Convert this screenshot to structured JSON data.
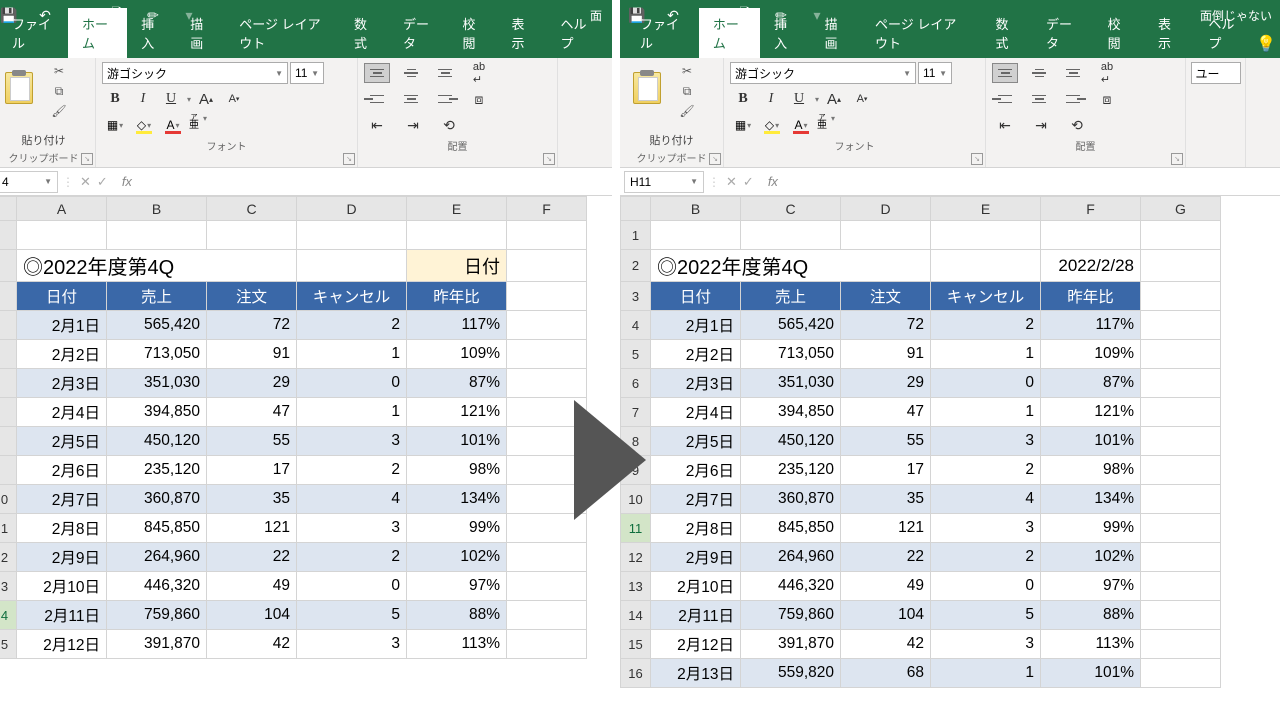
{
  "ribbon": {
    "tabs": [
      "ファイル",
      "ホーム",
      "挿入",
      "描画",
      "ページ レイアウト",
      "数式",
      "データ",
      "校閲",
      "表示",
      "ヘルプ"
    ],
    "paste": "貼り付け",
    "clipboard": "クリップボード",
    "font": "フォント",
    "align": "配置",
    "fontname": "游ゴシック",
    "fontsize": "11",
    "bold": "B",
    "italic": "I",
    "under": "U",
    "userStyle": "ユー"
  },
  "title_left": "面",
  "title_right": "面倒じゃない",
  "left": {
    "namebox": "4",
    "celltitle": "◎2022年度第4Q",
    "datebox": "日付",
    "headers": [
      "日付",
      "売上",
      "注文",
      "キャンセル",
      "昨年比"
    ],
    "rows": [
      [
        "2月1日",
        "565,420",
        "72",
        "2",
        "117%"
      ],
      [
        "2月2日",
        "713,050",
        "91",
        "1",
        "109%"
      ],
      [
        "2月3日",
        "351,030",
        "29",
        "0",
        "87%"
      ],
      [
        "2月4日",
        "394,850",
        "47",
        "1",
        "121%"
      ],
      [
        "2月5日",
        "450,120",
        "55",
        "3",
        "101%"
      ],
      [
        "2月6日",
        "235,120",
        "17",
        "2",
        "98%"
      ],
      [
        "2月7日",
        "360,870",
        "35",
        "4",
        "134%"
      ],
      [
        "2月8日",
        "845,850",
        "121",
        "3",
        "99%"
      ],
      [
        "2月9日",
        "264,960",
        "22",
        "2",
        "102%"
      ],
      [
        "2月10日",
        "446,320",
        "49",
        "0",
        "97%"
      ],
      [
        "2月11日",
        "759,860",
        "104",
        "5",
        "88%"
      ],
      [
        "2月12日",
        "391,870",
        "42",
        "3",
        "113%"
      ]
    ]
  },
  "right": {
    "namebox": "H11",
    "celltitle": "◎2022年度第4Q",
    "datebox": "2022/2/28",
    "headers": [
      "日付",
      "売上",
      "注文",
      "キャンセル",
      "昨年比"
    ],
    "rows": [
      [
        "2月1日",
        "565,420",
        "72",
        "2",
        "117%"
      ],
      [
        "2月2日",
        "713,050",
        "91",
        "1",
        "109%"
      ],
      [
        "2月3日",
        "351,030",
        "29",
        "0",
        "87%"
      ],
      [
        "2月4日",
        "394,850",
        "47",
        "1",
        "121%"
      ],
      [
        "2月5日",
        "450,120",
        "55",
        "3",
        "101%"
      ],
      [
        "2月6日",
        "235,120",
        "17",
        "2",
        "98%"
      ],
      [
        "2月7日",
        "360,870",
        "35",
        "4",
        "134%"
      ],
      [
        "2月8日",
        "845,850",
        "121",
        "3",
        "99%"
      ],
      [
        "2月9日",
        "264,960",
        "22",
        "2",
        "102%"
      ],
      [
        "2月10日",
        "446,320",
        "49",
        "0",
        "97%"
      ],
      [
        "2月11日",
        "759,860",
        "104",
        "5",
        "88%"
      ],
      [
        "2月12日",
        "391,870",
        "42",
        "3",
        "113%"
      ],
      [
        "2月13日",
        "559,820",
        "68",
        "1",
        "101%"
      ]
    ]
  }
}
